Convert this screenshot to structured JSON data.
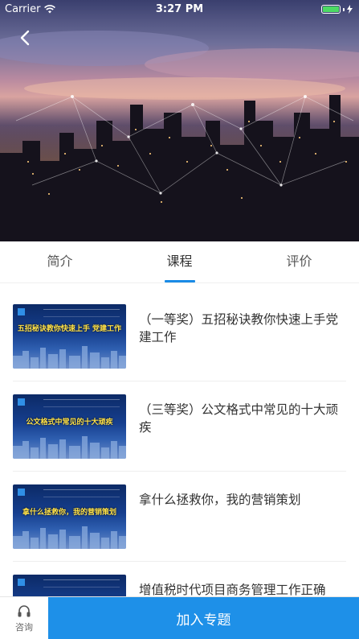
{
  "status_bar": {
    "carrier": "Carrier",
    "time": "3:27 PM",
    "battery_level": 1.0
  },
  "tabs": [
    {
      "label": "简介",
      "active": false
    },
    {
      "label": "课程",
      "active": true
    },
    {
      "label": "评价",
      "active": false
    }
  ],
  "courses": [
    {
      "title": "（一等奖）五招秘诀教你快速上手党建工作",
      "thumb_title": "五招秘诀教你快速上手 党建工作"
    },
    {
      "title": "（三等奖）公文格式中常见的十大顽疾",
      "thumb_title": "公文格式中常见的十大顽疾"
    },
    {
      "title": "拿什么拯救你，我的营销策划",
      "thumb_title": "拿什么拯救你，我的营销策划"
    },
    {
      "title": "增值税时代项目商务管理工作正确",
      "thumb_title": ""
    }
  ],
  "bottom_bar": {
    "consult_label": "咨询",
    "join_label": "加入专题"
  },
  "colors": {
    "accent": "#1e90e8",
    "tab_underline": "#1a8be6",
    "battery": "#4cd964"
  },
  "icons": {
    "back": "back-arrow-icon",
    "consult": "headset-icon",
    "wifi": "wifi-icon",
    "charging": "bolt-icon"
  }
}
